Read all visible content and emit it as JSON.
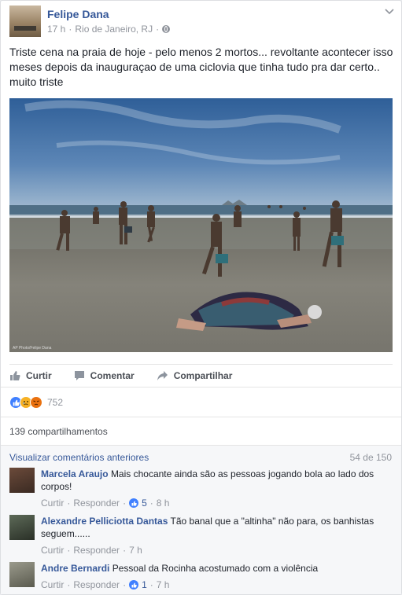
{
  "post": {
    "author": "Felipe Dana",
    "time": "17 h",
    "dot": "·",
    "location": "Rio de Janeiro, RJ",
    "text": "Triste cena na praia de hoje - pelo menos 2 mortos... revoltante acontecer isso meses depois da inauguraçao de uma ciclovia que tinha tudo pra dar certo.. muito triste",
    "photo_credit": "AP Photo/Felipe Dana"
  },
  "actions": {
    "like": "Curtir",
    "comment": "Comentar",
    "share": "Compartilhar"
  },
  "reactions": {
    "count": "752",
    "types": [
      "like",
      "sad",
      "angry"
    ],
    "colors": {
      "like": "#4080ff",
      "sad": "#f7b125",
      "angry": "#e9710f"
    }
  },
  "shares": "139 compartilhamentos",
  "comments_section": {
    "previous_link": "Visualizar comentários anteriores",
    "count": "54 de 150",
    "items": [
      {
        "name": "Marcela Araujo",
        "text": "Mais chocante ainda são as pessoas jogando bola ao lado dos corpos!",
        "like": "Curtir",
        "reply": "Responder",
        "likes": "5",
        "time": "8 h"
      },
      {
        "name": "Alexandre Pelliciotta Dantas",
        "text": "Tão banal que a \"altinha\" não para, os banhistas seguem......",
        "like": "Curtir",
        "reply": "Responder",
        "likes": "",
        "time": "7 h"
      },
      {
        "name": "Andre Bernardi",
        "text": "Pessoal da Rocinha acostumado com a violência",
        "like": "Curtir",
        "reply": "Responder",
        "likes": "1",
        "time": "7 h"
      }
    ]
  },
  "colors": {
    "link": "#365899",
    "muted": "#90949c",
    "text": "#1d2129"
  }
}
